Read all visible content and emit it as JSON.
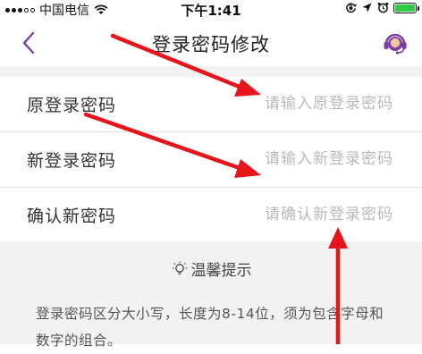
{
  "status_bar": {
    "carrier": "中国电信",
    "time": "下午1:41"
  },
  "nav": {
    "title": "登录密码修改",
    "back_icon": "chevron-left-icon",
    "service_icon": "headset-service-icon"
  },
  "form": {
    "rows": [
      {
        "label": "原登录密码",
        "placeholder": "请输入原登录密码"
      },
      {
        "label": "新登录密码",
        "placeholder": "请输入新登录密码"
      },
      {
        "label": "确认新密码",
        "placeholder": "请确认新登录密码"
      }
    ]
  },
  "tips": {
    "icon": "lightbulb-icon",
    "title": "温馨提示",
    "text": "登录密码区分大小写，长度为8-14位，须为包含字母和数字的组合。"
  },
  "colors": {
    "accent": "#7a3fa0",
    "annotation": "#e8141b",
    "battery": "#2ecc40"
  }
}
